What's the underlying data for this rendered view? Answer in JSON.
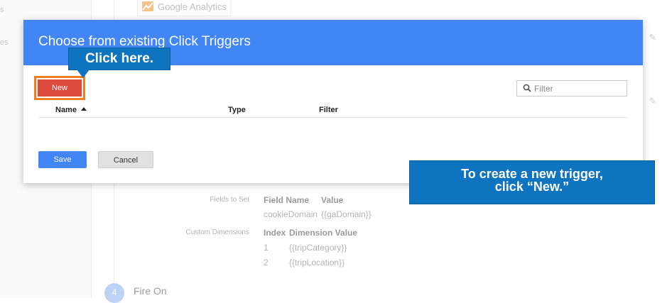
{
  "background": {
    "left_nav": [
      "s",
      "es"
    ],
    "ga_card_text": "Google Analytics",
    "fields_to_set": {
      "label": "Fields to Set",
      "headers": [
        "Field Name",
        "Value"
      ],
      "row": [
        "cookieDomain",
        "{{gaDomain}}"
      ]
    },
    "custom_dimensions": {
      "label": "Custom Dimensions",
      "headers": [
        "Index",
        "Dimension Value"
      ],
      "rows": [
        [
          "1",
          "{{tripCategory}}"
        ],
        [
          "2",
          "{{tripLocation}}"
        ]
      ]
    },
    "step": {
      "number": "4",
      "title": "Fire On"
    }
  },
  "modal": {
    "title": "Choose from existing Click Triggers",
    "new_label": "New",
    "filter_placeholder": "Filter",
    "columns": [
      "Name",
      "Type",
      "Filter"
    ],
    "save_label": "Save",
    "cancel_label": "Cancel"
  },
  "callouts": {
    "click_here": "Click here.",
    "instruction_line1": "To create a new trigger,",
    "instruction_line2": "click “New.”"
  },
  "colors": {
    "header_blue": "#4285f4",
    "new_red": "#df4a3c",
    "highlight_orange": "#f47b20",
    "callout_blue": "#0f74bf"
  }
}
